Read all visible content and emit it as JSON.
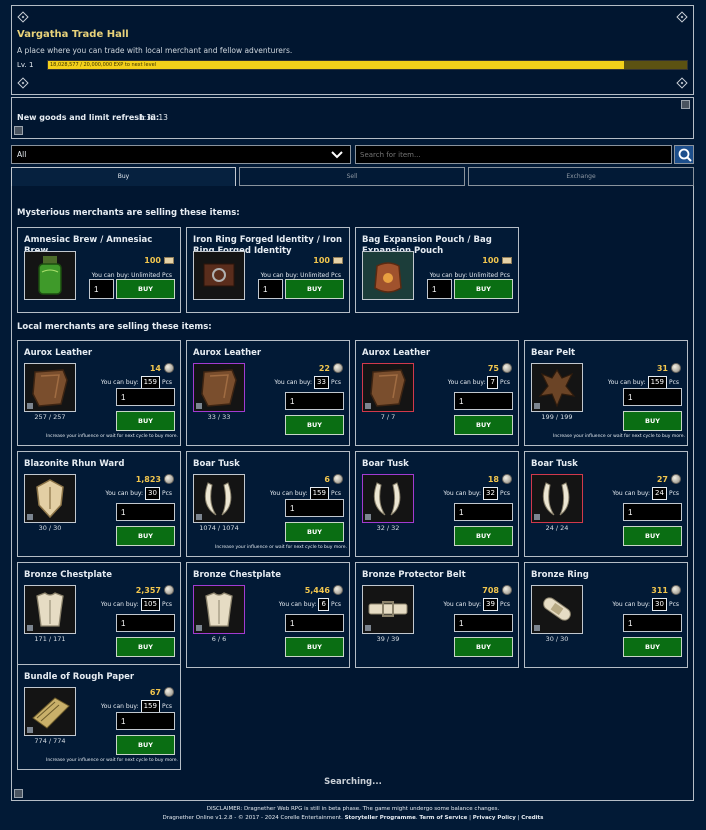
{
  "header": {
    "title": "Vargatha Trade Hall",
    "subtitle": "A place where you can trade with local merchant and fellow adventurers.",
    "level": "Lv. 1",
    "exp_text": "18,028,577 / 20,000,000 EXP to next level",
    "exp_progress": 0.9014,
    "exp_color": "#f3d01a"
  },
  "refresh": {
    "label": "New goods and limit refresh in:",
    "timer": "1:32:13"
  },
  "filter": {
    "category_value": "All",
    "search_placeholder": "Search for item..."
  },
  "tabs": [
    "Buy",
    "Sell",
    "Exchange"
  ],
  "sections": {
    "mysterious": "Mysterious merchants are selling these items:",
    "local": "Local merchants are selling these items:"
  },
  "labels": {
    "buy": "BUY",
    "you_can_buy": "You can buy:",
    "pcs": "Pcs",
    "note": "Increase your influence or wait for next cycle to buy more."
  },
  "mysterious_items": [
    {
      "name": "Amnesiac Brew / Amnesiac Brew",
      "price": "100",
      "limit": "You can buy: Unlimited Pcs",
      "qty": "1"
    },
    {
      "name": "Iron Ring Forged Identity / Iron Ring Forged Identity",
      "price": "100",
      "limit": "You can buy: Unlimited Pcs",
      "qty": "1"
    },
    {
      "name": "Bag Expansion Pouch / Bag Expansion Pouch",
      "price": "100",
      "limit": "You can buy: Unlimited Pcs",
      "qty": "1"
    }
  ],
  "local_items": [
    {
      "name": "Aurox Leather",
      "price": "14",
      "limit": "159",
      "qty": "1",
      "stock": "257 / 257",
      "rarity": "common",
      "icon": "leather-icon",
      "note": true
    },
    {
      "name": "Aurox Leather",
      "price": "22",
      "limit": "33",
      "qty": "1",
      "stock": "33 / 33",
      "rarity": "epic",
      "icon": "leather-icon",
      "note": false
    },
    {
      "name": "Aurox Leather",
      "price": "75",
      "limit": "7",
      "qty": "1",
      "stock": "7 / 7",
      "rarity": "legendary",
      "icon": "leather-icon",
      "note": false
    },
    {
      "name": "Bear Pelt",
      "price": "31",
      "limit": "159",
      "qty": "1",
      "stock": "199 / 199",
      "rarity": "common",
      "icon": "pelt-icon",
      "note": true
    },
    {
      "name": "Blazonite Rhun Ward",
      "price": "1,823",
      "limit": "30",
      "qty": "1",
      "stock": "30 / 30",
      "rarity": "common",
      "icon": "ward-icon",
      "note": false
    },
    {
      "name": "Boar Tusk",
      "price": "6",
      "limit": "159",
      "qty": "1",
      "stock": "1074 / 1074",
      "rarity": "common",
      "icon": "tusk-icon",
      "note": true
    },
    {
      "name": "Boar Tusk",
      "price": "18",
      "limit": "32",
      "qty": "1",
      "stock": "32 / 32",
      "rarity": "epic",
      "icon": "tusk-icon",
      "note": false
    },
    {
      "name": "Boar Tusk",
      "price": "27",
      "limit": "24",
      "qty": "1",
      "stock": "24 / 24",
      "rarity": "legendary",
      "icon": "tusk-icon",
      "note": false
    },
    {
      "name": "Bronze Chestplate",
      "price": "2,357",
      "limit": "105",
      "qty": "1",
      "stock": "171 / 171",
      "rarity": "common",
      "icon": "chestplate-icon",
      "note": false
    },
    {
      "name": "Bronze Chestplate",
      "price": "5,446",
      "limit": "6",
      "qty": "1",
      "stock": "6 / 6",
      "rarity": "epic",
      "icon": "chestplate-icon",
      "note": false
    },
    {
      "name": "Bronze Protector Belt",
      "price": "708",
      "limit": "39",
      "qty": "1",
      "stock": "39 / 39",
      "rarity": "common",
      "icon": "belt-icon",
      "note": false
    },
    {
      "name": "Bronze Ring",
      "price": "311",
      "limit": "30",
      "qty": "1",
      "stock": "30 / 30",
      "rarity": "common",
      "icon": "ring-icon",
      "note": false
    },
    {
      "name": "Bundle of Rough Paper",
      "price": "67",
      "limit": "159",
      "qty": "1",
      "stock": "774 / 774",
      "rarity": "common",
      "icon": "paper-bundle-icon",
      "note": true
    }
  ],
  "status": "Searching...",
  "footer": {
    "disclaimer": "DISCLAIMER: Dragnether Web RPG is still in beta phase. The game might undergo some balance changes.",
    "credits_prefix": "Dragnether Online v1.2.8 - © 2017 - 2024 Corelle Entertainment.",
    "storyteller": "Storyteller Programme",
    "terms": "Term of Service",
    "privacy": "Privacy Policy",
    "credits": "Credits"
  }
}
